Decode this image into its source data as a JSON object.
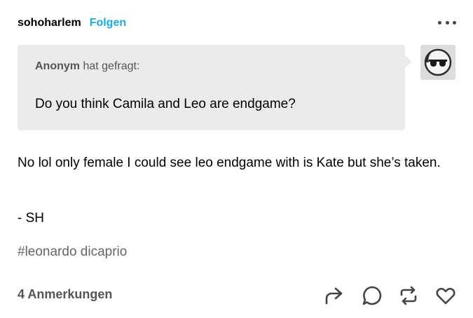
{
  "post": {
    "username": "sohoharlem",
    "follow_label": "Folgen",
    "more_icon": "more-horizontal-icon"
  },
  "ask": {
    "asker": "Anonym",
    "asked_text": "hat gefragt:",
    "question": "Do you think Camila and Leo are endgame?",
    "avatar_icon": "sunglasses-avatar-icon"
  },
  "answer": {
    "text": "No lol only female I could see leo endgame with is Kate but she’s taken.",
    "signature": "- SH"
  },
  "tags": [
    "#leonardo dicaprio"
  ],
  "footer": {
    "notes": "4 Anmerkungen",
    "actions": [
      "share-icon",
      "reply-icon",
      "reblog-icon",
      "like-icon"
    ]
  },
  "colors": {
    "accent": "#1aabe6",
    "ask_background": "#ebebeb",
    "muted_text": "#555555",
    "tag_text": "#666666"
  }
}
